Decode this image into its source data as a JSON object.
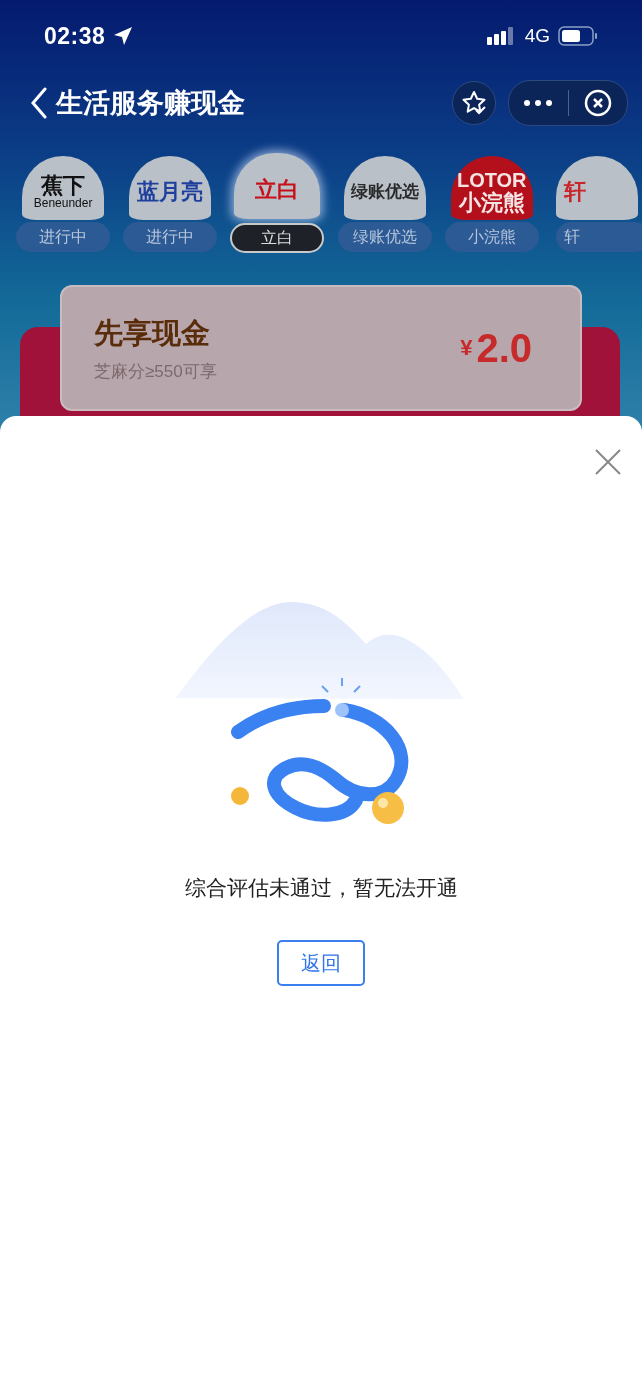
{
  "status_bar": {
    "time": "02:38",
    "network": "4G"
  },
  "nav": {
    "title": "生活服务赚现金"
  },
  "brands": [
    {
      "logo": [
        "蕉下",
        "Beneunder"
      ],
      "kind": "plain",
      "color": "#111111",
      "label": "进行中",
      "selected": false
    },
    {
      "logo": [
        "蓝月亮"
      ],
      "kind": "plain",
      "color": "#1f3f9f",
      "label": "进行中",
      "selected": false
    },
    {
      "logo": [
        "立白"
      ],
      "kind": "plain",
      "color": "#c8101a",
      "label": "立白",
      "selected": true
    },
    {
      "logo": [
        "绿账优选"
      ],
      "kind": "plain",
      "color": "#2a2a2a",
      "label": "绿账优选",
      "selected": false
    },
    {
      "logo": [
        "LOTOR",
        "小浣熊"
      ],
      "kind": "red",
      "color": "#f4e4e4",
      "label": "小浣熊",
      "selected": false
    },
    {
      "logo": [
        "轩"
      ],
      "kind": "cut",
      "color": "#c8262a",
      "label": "轩",
      "selected": false
    }
  ],
  "promo": {
    "title": "先享现金",
    "subtitle": "芝麻分≥550可享",
    "currency": "¥",
    "amount": "2.0"
  },
  "sheet": {
    "message": "综合评估未通过，暂无法开通",
    "button": "返回"
  }
}
